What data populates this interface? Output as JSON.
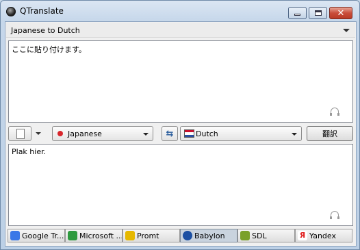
{
  "window": {
    "title": "QTranslate"
  },
  "direction": {
    "label": "Japanese to Dutch"
  },
  "source": {
    "text": "ここに貼り付けます。"
  },
  "result": {
    "text": "Plak hier."
  },
  "languages": {
    "source": "Japanese",
    "target": "Dutch"
  },
  "translate_button": {
    "label": "翻訳"
  },
  "engines": [
    {
      "name": "Google Tr...",
      "icon": "google-icon",
      "color": "#3b78e7"
    },
    {
      "name": "Microsoft ...",
      "icon": "microsoft-icon",
      "color": "#2e9a3f"
    },
    {
      "name": "Promt",
      "icon": "promt-icon",
      "color": "#e6b800"
    },
    {
      "name": "Babylon",
      "icon": "babylon-icon",
      "color": "#1b4fa3"
    },
    {
      "name": "SDL",
      "icon": "sdl-icon",
      "color": "#7aa02a"
    },
    {
      "name": "Yandex",
      "icon": "yandex-icon",
      "color": "#e02020"
    }
  ],
  "active_engine": "Babylon"
}
